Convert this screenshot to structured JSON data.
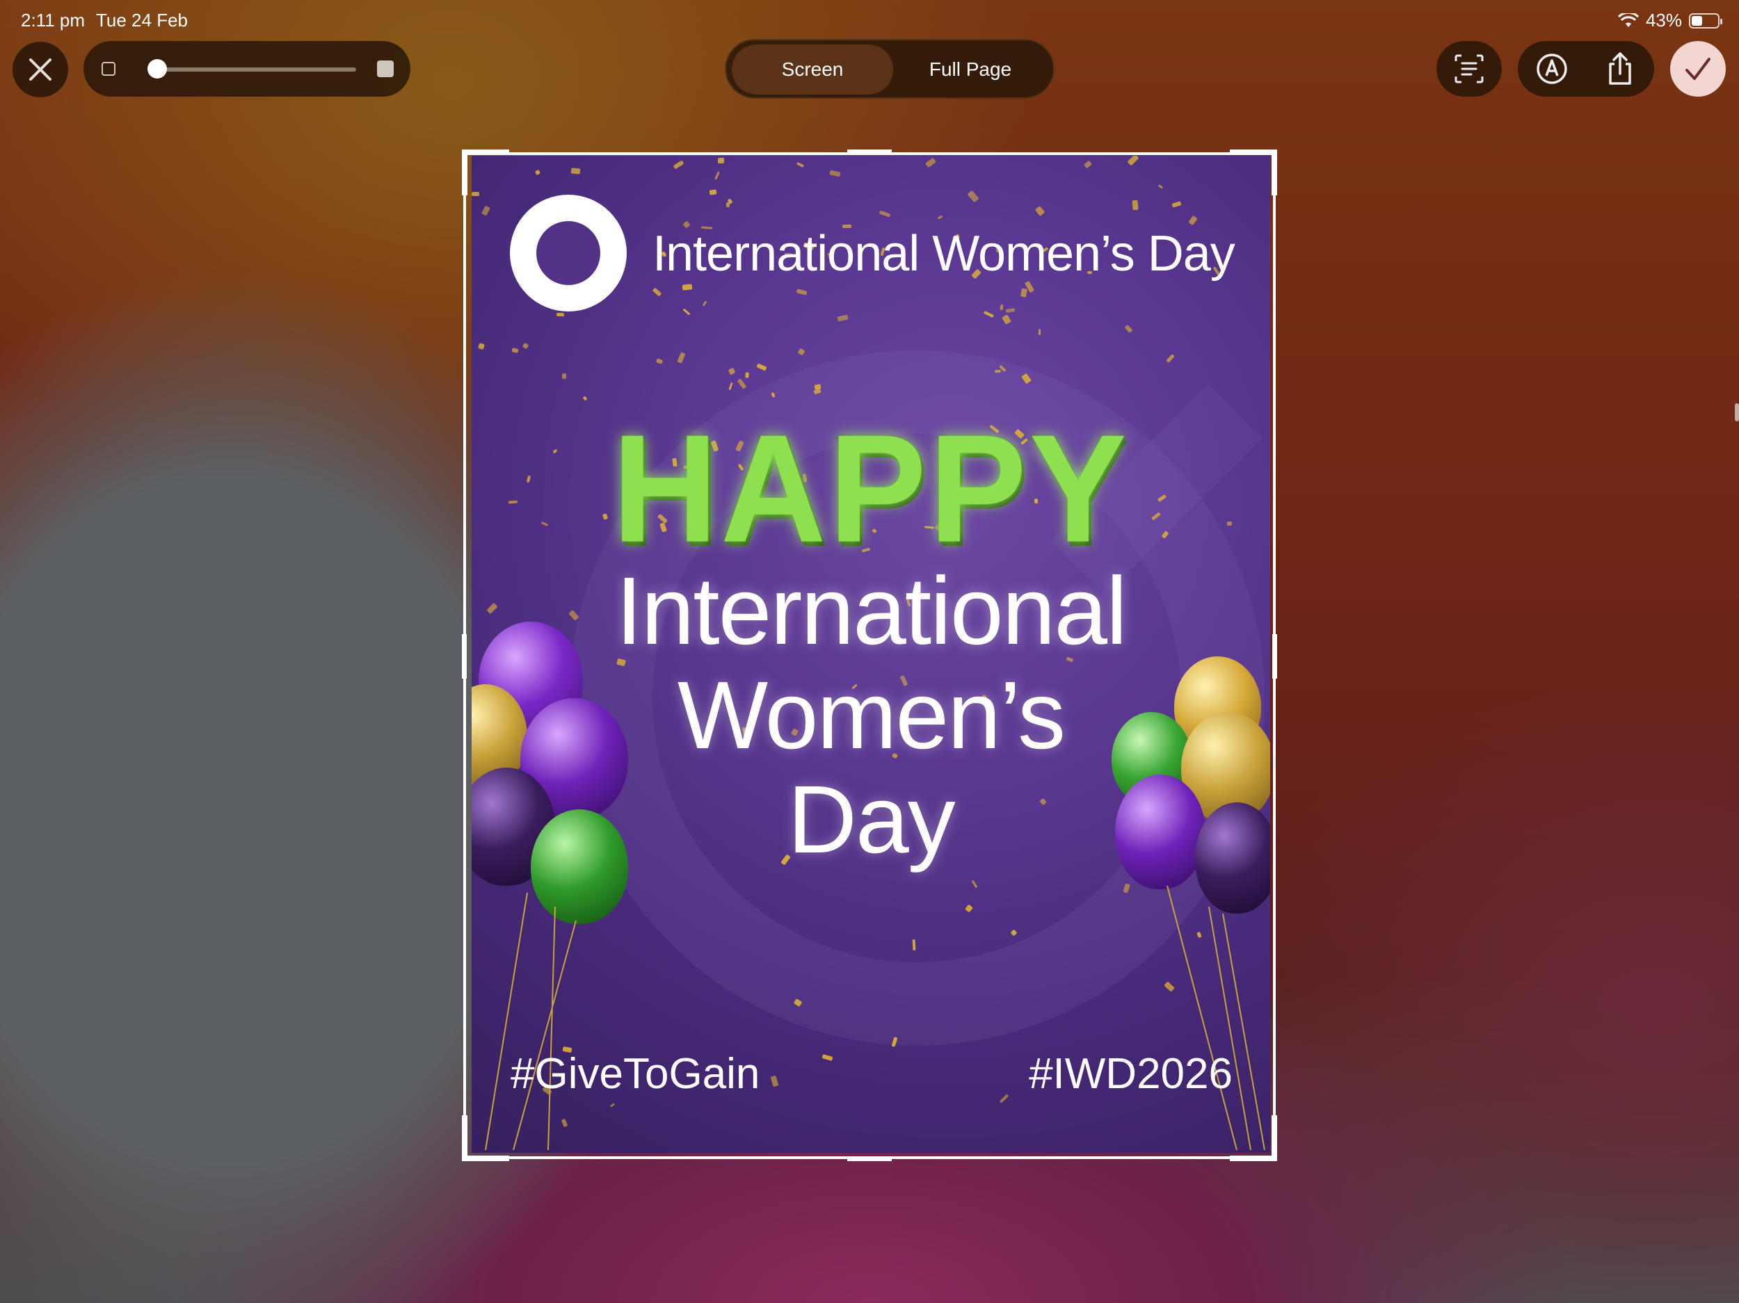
{
  "status_bar": {
    "time": "2:11 pm",
    "date": "Tue 24 Feb",
    "battery_percent_label": "43%",
    "battery_level": 0.43
  },
  "toolbar": {
    "close_icon": "close-icon",
    "size_slider_value": 0.0,
    "segments": [
      {
        "label": "Screen",
        "active": true
      },
      {
        "label": "Full Page",
        "active": false
      }
    ],
    "text_select_icon": "text-select-icon",
    "markup_icon": "markup-pen-icon",
    "share_icon": "share-icon",
    "done_icon": "checkmark-icon"
  },
  "poster": {
    "header_text": "International Women’s Day",
    "happy_text": "HAPPY",
    "headline_lines": [
      "International",
      "Women’s",
      "Day"
    ],
    "hashtag_left": "#GiveToGain",
    "hashtag_right": "#IWD2026"
  },
  "colors": {
    "poster_purple": "#533186",
    "happy_green": "#8fe04f",
    "confetti_gold": "#d7a93a",
    "done_button": "#f3d5d2"
  }
}
